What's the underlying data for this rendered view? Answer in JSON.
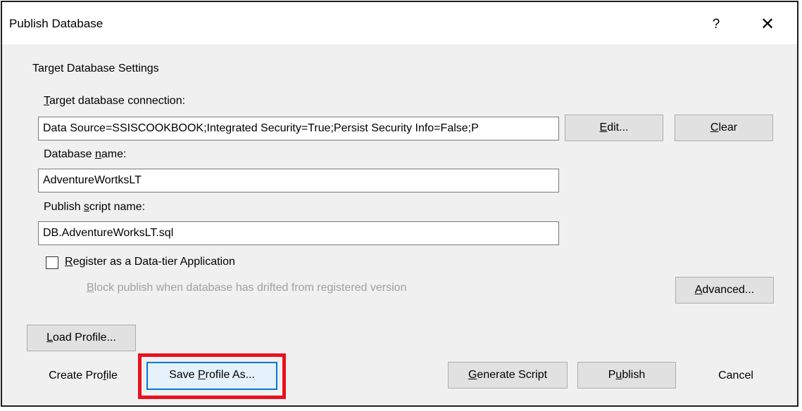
{
  "dialog": {
    "title": "Publish Database",
    "help_glyph": "?",
    "close_glyph": "✕"
  },
  "section_title": "Target Database Settings",
  "connection": {
    "label_key": "T",
    "label_rest": "arget database connection:",
    "value": "Data Source=SSISCOOKBOOK;Integrated Security=True;Persist Security Info=False;P",
    "edit_key": "E",
    "edit_rest": "dit...",
    "clear_key": "C",
    "clear_rest": "lear"
  },
  "database_name": {
    "label_pre": "Database ",
    "label_key": "n",
    "label_rest": "ame:",
    "value": "AdventureWortksLT"
  },
  "script_name": {
    "label_pre": "Publish ",
    "label_key": "s",
    "label_rest": "cript name:",
    "value": "DB.AdventureWorksLT.sql"
  },
  "register": {
    "label_key": "R",
    "label_rest": "egister as a Data-tier Application",
    "checked": false,
    "block_key": "B",
    "block_rest": "lock publish when database has drifted from registered version"
  },
  "buttons": {
    "advanced_key": "A",
    "advanced_rest": "dvanced...",
    "load_key": "L",
    "load_rest": "oad Profile...",
    "create_pre": "Create Pro",
    "create_key": "f",
    "create_rest": "ile",
    "save_pre": "Save ",
    "save_key": "P",
    "save_rest": "rofile As...",
    "generate_key": "G",
    "generate_rest": "enerate Script",
    "publish_pre": "P",
    "publish_key": "u",
    "publish_rest": "blish",
    "cancel": "Cancel"
  },
  "colors": {
    "highlight": "#e8121d",
    "focus": "#0078d7"
  }
}
